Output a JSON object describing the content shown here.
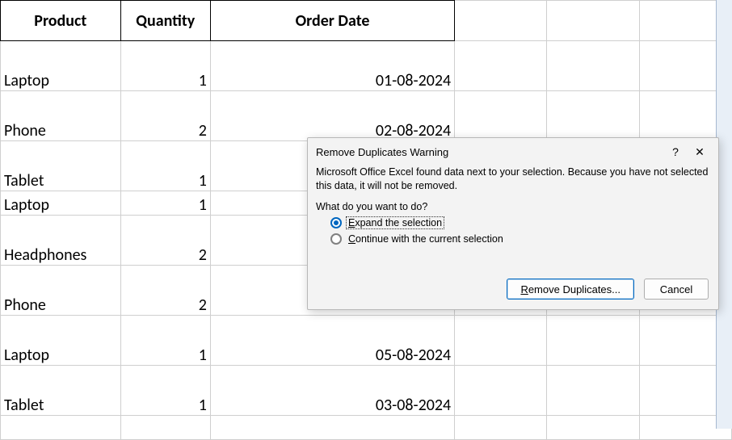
{
  "table": {
    "headers": [
      "Product",
      "Quantity",
      "Order Date"
    ],
    "rows": [
      {
        "product": "Laptop",
        "qty": "1",
        "date": "01-08-2024"
      },
      {
        "product": "Phone",
        "qty": "2",
        "date": "02-08-2024"
      },
      {
        "product": "Tablet",
        "qty": "1",
        "date": ""
      },
      {
        "product": "Laptop",
        "qty": "1",
        "date": ""
      },
      {
        "product": "Headphones",
        "qty": "2",
        "date": ""
      },
      {
        "product": "Phone",
        "qty": "2",
        "date": ""
      },
      {
        "product": "Laptop",
        "qty": "1",
        "date": "05-08-2024"
      },
      {
        "product": "Tablet",
        "qty": "1",
        "date": "03-08-2024"
      }
    ]
  },
  "dialog": {
    "title": "Remove Duplicates Warning",
    "help_symbol": "?",
    "close_symbol": "✕",
    "message": "Microsoft Office Excel found data next to your selection. Because you have not selected this data, it will not be removed.",
    "prompt": "What do you want to do?",
    "option_expand_prefix": "E",
    "option_expand_rest": "xpand the selection",
    "option_continue_prefix": "C",
    "option_continue_rest": "ontinue with the current selection",
    "btn_remove_prefix": "R",
    "btn_remove_rest": "emove Duplicates...",
    "btn_cancel": "Cancel"
  }
}
